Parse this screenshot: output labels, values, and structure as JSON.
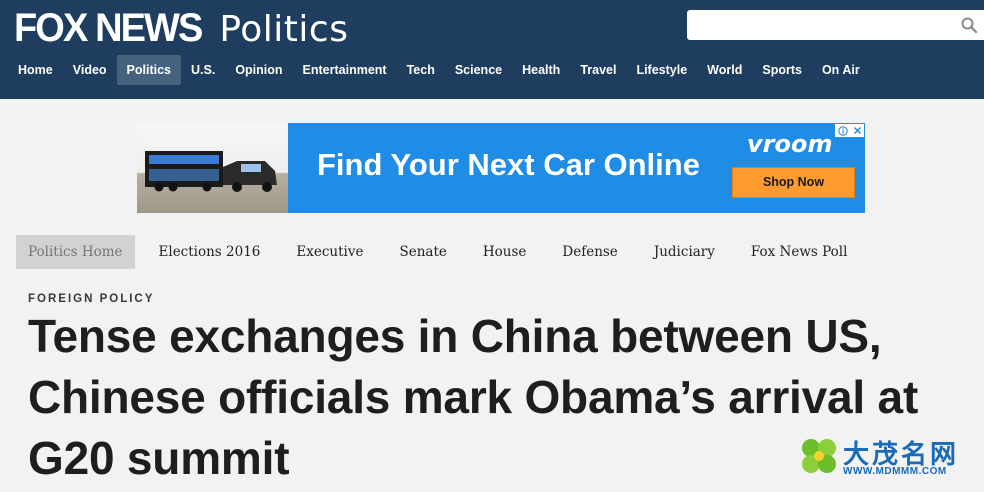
{
  "header": {
    "brand_fox": "FOX NEWS",
    "brand_section": "Politics",
    "search": {
      "placeholder": "",
      "icon": "search-icon"
    },
    "nav": [
      {
        "label": "Home",
        "active": false
      },
      {
        "label": "Video",
        "active": false
      },
      {
        "label": "Politics",
        "active": true
      },
      {
        "label": "U.S.",
        "active": false
      },
      {
        "label": "Opinion",
        "active": false
      },
      {
        "label": "Entertainment",
        "active": false
      },
      {
        "label": "Tech",
        "active": false
      },
      {
        "label": "Science",
        "active": false
      },
      {
        "label": "Health",
        "active": false
      },
      {
        "label": "Travel",
        "active": false
      },
      {
        "label": "Lifestyle",
        "active": false
      },
      {
        "label": "World",
        "active": false
      },
      {
        "label": "Sports",
        "active": false
      },
      {
        "label": "On Air",
        "active": false
      }
    ]
  },
  "ad": {
    "headline": "Find Your Next Car Online",
    "brand": "vroom",
    "cta": "Shop Now",
    "choices_icon": "info-icon",
    "close_icon": "close-icon"
  },
  "section_nav": [
    {
      "label": "Politics Home",
      "active": true
    },
    {
      "label": "Elections 2016",
      "active": false
    },
    {
      "label": "Executive",
      "active": false
    },
    {
      "label": "Senate",
      "active": false
    },
    {
      "label": "House",
      "active": false
    },
    {
      "label": "Defense",
      "active": false
    },
    {
      "label": "Judiciary",
      "active": false
    },
    {
      "label": "Fox News Poll",
      "active": false
    }
  ],
  "article": {
    "kicker": "FOREIGN POLICY",
    "headline": "Tense exchanges in China between US, Chinese officials mark Obama’s arrival at G20 summit"
  },
  "watermark": {
    "text": "大茂名网",
    "url": "WWW.MDMMM.COM"
  },
  "colors": {
    "header_bg": "#1e3d5f",
    "nav_active": "#47627f",
    "ad_bg": "#1f8ce6",
    "cta_bg": "#ff9a2e",
    "page_bg": "#f2f2f2"
  }
}
